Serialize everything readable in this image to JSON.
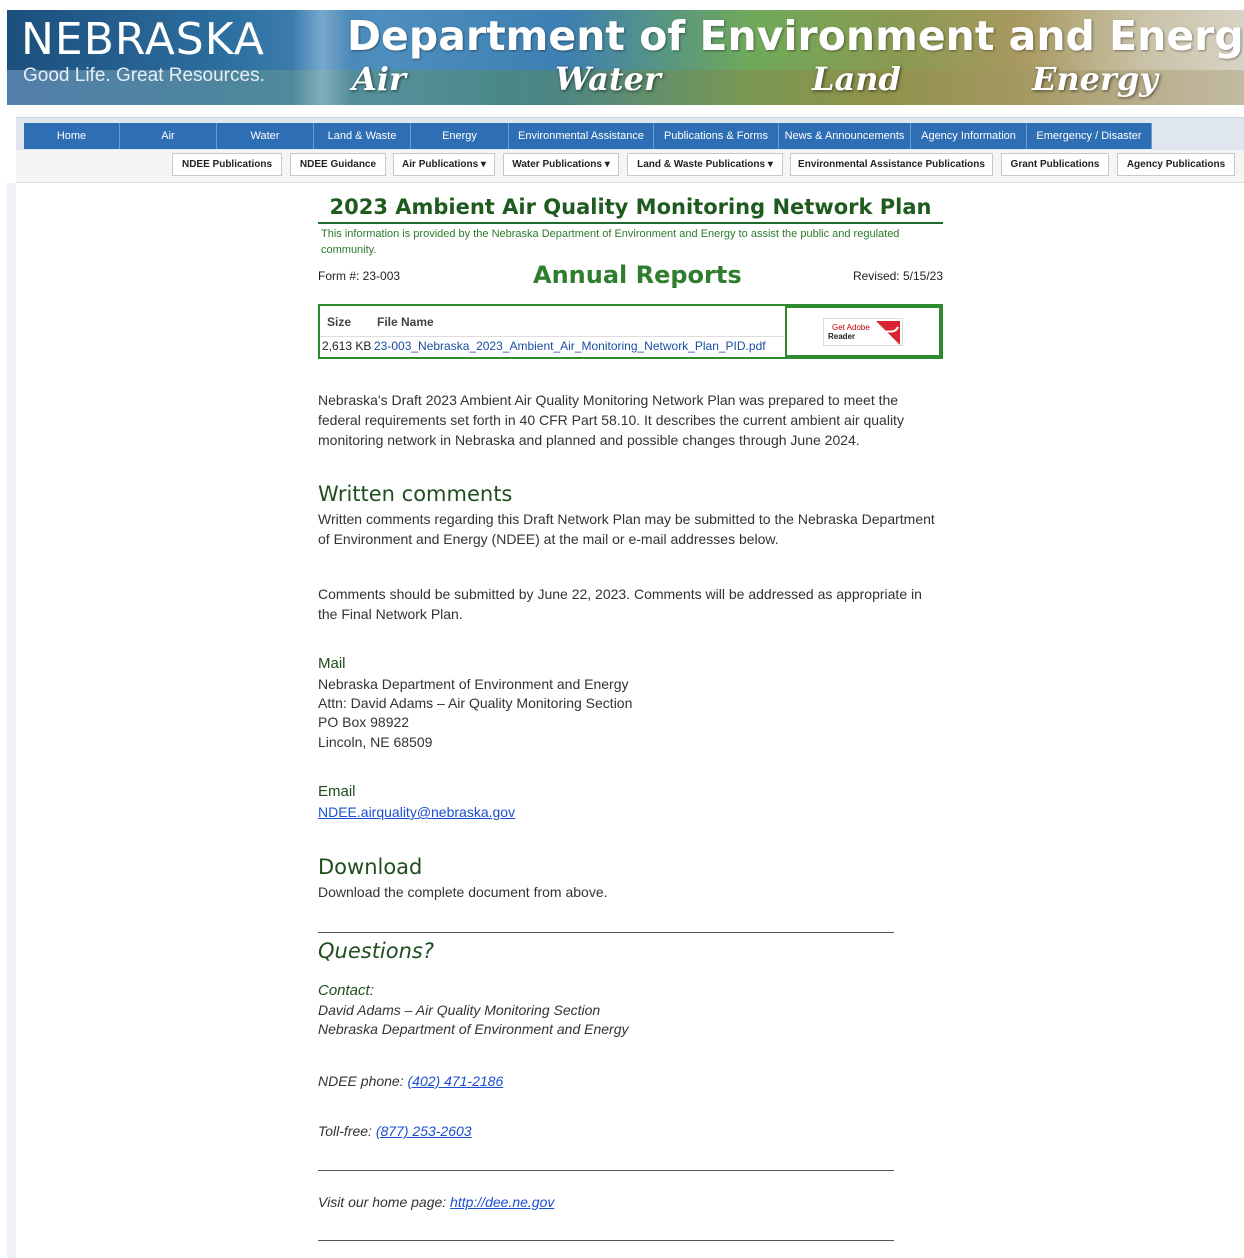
{
  "banner": {
    "brand": "NEBRASKA",
    "tagline": "Good Life. Great Resources.",
    "department": "Department of Environment and Energy",
    "themes": [
      "Air",
      "Water",
      "Land",
      "Energy"
    ]
  },
  "main_nav": [
    "Home",
    "Air",
    "Water",
    "Land & Waste",
    "Energy",
    "Environmental Assistance",
    "Publications & Forms",
    "News & Announcements",
    "Agency Information",
    "Emergency / Disaster"
  ],
  "sub_nav": [
    "NDEE Publications",
    "NDEE Guidance",
    "Air Publications ▾",
    "Water Publications ▾",
    "Land & Waste Publications ▾",
    "Environmental Assistance Publications",
    "Grant Publications",
    "Agency Publications"
  ],
  "page": {
    "title": "2023 Ambient Air Quality Monitoring Network Plan",
    "intro": "This information is provided by the Nebraska Department of Environment and Energy to assist the public and regulated community.",
    "form_no": "Form #: 23-003",
    "section_heading": "Annual Reports",
    "revised": "Revised: 5/15/23"
  },
  "file_table": {
    "col_size": "Size",
    "col_name": "File Name",
    "size": "2,613 KB",
    "file_name": "23-003_Nebraska_2023_Ambient_Air_Monitoring_Network_Plan_PID.pdf",
    "adobe_get": "Get Adobe",
    "adobe_reader": "Reader"
  },
  "body": {
    "description": "Nebraska's Draft 2023 Ambient Air Quality Monitoring Network Plan was prepared to meet the federal requirements set forth in 40 CFR Part 58.10. It describes the current ambient air quality monitoring network in Nebraska and planned and possible changes through June 2024.",
    "written_heading": "Written comments",
    "written_text": "Written comments regarding this Draft Network Plan may be submitted to the Nebraska Department of Environment and Energy (NDEE) at the mail or e-mail addresses below.",
    "deadline_text": "Comments should be submitted by June 22, 2023. Comments will be addressed as appropriate in the Final Network Plan.",
    "mail_heading": "Mail",
    "mail_lines": [
      "Nebraska Department of Environment and Energy",
      "Attn: David Adams – Air Quality Monitoring Section",
      "PO Box 98922",
      "Lincoln, NE 68509"
    ],
    "email_heading": "Email",
    "email": "NDEE.airquality@nebraska.gov",
    "download_heading": "Download",
    "download_text": "Download the complete document from above.",
    "questions_heading": "Questions?",
    "contact_label": "Contact:",
    "contact_name": "David Adams – Air Quality Monitoring Section",
    "contact_org": "Nebraska Department of Environment and Energy",
    "phone_label": "NDEE phone: ",
    "phone": "(402) 471-2186",
    "tollfree_label": "Toll-free: ",
    "tollfree": "(877) 253-2603",
    "home_label": "Visit our home page: ",
    "home_url": "http://dee.ne.gov"
  }
}
